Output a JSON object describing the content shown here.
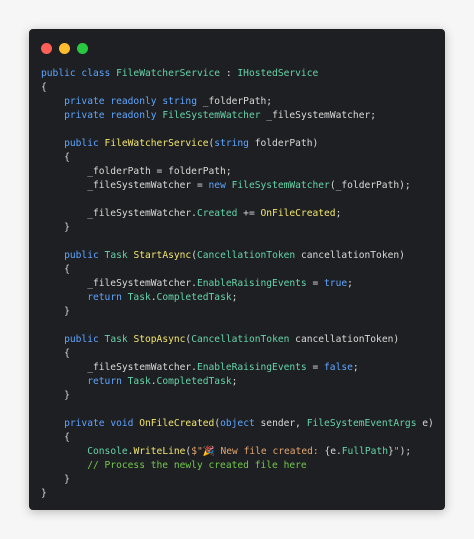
{
  "window": {
    "dots": [
      {
        "name": "close",
        "color": "#ff5f57"
      },
      {
        "name": "minimize",
        "color": "#febc2e"
      },
      {
        "name": "zoom",
        "color": "#28c840"
      }
    ]
  },
  "code_lines": [
    [
      {
        "t": "public class ",
        "c": "k"
      },
      {
        "t": "FileWatcherService",
        "c": "t"
      },
      {
        "t": " : ",
        "c": "p"
      },
      {
        "t": "IHostedService",
        "c": "t"
      }
    ],
    [
      {
        "t": "{",
        "c": "p"
      }
    ],
    [
      {
        "t": "    ",
        "c": "p"
      },
      {
        "t": "private readonly ",
        "c": "k"
      },
      {
        "t": "string",
        "c": "k"
      },
      {
        "t": " _folderPath;",
        "c": "v"
      }
    ],
    [
      {
        "t": "    ",
        "c": "p"
      },
      {
        "t": "private readonly ",
        "c": "k"
      },
      {
        "t": "FileSystemWatcher",
        "c": "t"
      },
      {
        "t": " _fileSystemWatcher;",
        "c": "v"
      }
    ],
    [],
    [
      {
        "t": "    ",
        "c": "p"
      },
      {
        "t": "public ",
        "c": "k"
      },
      {
        "t": "FileWatcherService",
        "c": "f"
      },
      {
        "t": "(",
        "c": "p"
      },
      {
        "t": "string",
        "c": "k"
      },
      {
        "t": " folderPath)",
        "c": "v"
      }
    ],
    [
      {
        "t": "    {",
        "c": "p"
      }
    ],
    [
      {
        "t": "        _folderPath = folderPath;",
        "c": "v"
      }
    ],
    [
      {
        "t": "        _fileSystemWatcher = ",
        "c": "v"
      },
      {
        "t": "new ",
        "c": "k"
      },
      {
        "t": "FileSystemWatcher",
        "c": "t"
      },
      {
        "t": "(_folderPath);",
        "c": "v"
      }
    ],
    [],
    [
      {
        "t": "        _fileSystemWatcher.",
        "c": "v"
      },
      {
        "t": "Created",
        "c": "t"
      },
      {
        "t": " += ",
        "c": "p"
      },
      {
        "t": "OnFileCreated",
        "c": "f"
      },
      {
        "t": ";",
        "c": "p"
      }
    ],
    [
      {
        "t": "    }",
        "c": "p"
      }
    ],
    [],
    [
      {
        "t": "    ",
        "c": "p"
      },
      {
        "t": "public ",
        "c": "k"
      },
      {
        "t": "Task",
        "c": "t"
      },
      {
        "t": " ",
        "c": "p"
      },
      {
        "t": "StartAsync",
        "c": "f"
      },
      {
        "t": "(",
        "c": "p"
      },
      {
        "t": "CancellationToken",
        "c": "t"
      },
      {
        "t": " cancellationToken)",
        "c": "v"
      }
    ],
    [
      {
        "t": "    {",
        "c": "p"
      }
    ],
    [
      {
        "t": "        _fileSystemWatcher.",
        "c": "v"
      },
      {
        "t": "EnableRaisingEvents",
        "c": "t"
      },
      {
        "t": " = ",
        "c": "p"
      },
      {
        "t": "true",
        "c": "k"
      },
      {
        "t": ";",
        "c": "p"
      }
    ],
    [
      {
        "t": "        ",
        "c": "p"
      },
      {
        "t": "return ",
        "c": "k"
      },
      {
        "t": "Task",
        "c": "t"
      },
      {
        "t": ".",
        "c": "p"
      },
      {
        "t": "CompletedTask",
        "c": "t"
      },
      {
        "t": ";",
        "c": "p"
      }
    ],
    [
      {
        "t": "    }",
        "c": "p"
      }
    ],
    [],
    [
      {
        "t": "    ",
        "c": "p"
      },
      {
        "t": "public ",
        "c": "k"
      },
      {
        "t": "Task",
        "c": "t"
      },
      {
        "t": " ",
        "c": "p"
      },
      {
        "t": "StopAsync",
        "c": "f"
      },
      {
        "t": "(",
        "c": "p"
      },
      {
        "t": "CancellationToken",
        "c": "t"
      },
      {
        "t": " cancellationToken)",
        "c": "v"
      }
    ],
    [
      {
        "t": "    {",
        "c": "p"
      }
    ],
    [
      {
        "t": "        _fileSystemWatcher.",
        "c": "v"
      },
      {
        "t": "EnableRaisingEvents",
        "c": "t"
      },
      {
        "t": " = ",
        "c": "p"
      },
      {
        "t": "false",
        "c": "k"
      },
      {
        "t": ";",
        "c": "p"
      }
    ],
    [
      {
        "t": "        ",
        "c": "p"
      },
      {
        "t": "return ",
        "c": "k"
      },
      {
        "t": "Task",
        "c": "t"
      },
      {
        "t": ".",
        "c": "p"
      },
      {
        "t": "CompletedTask",
        "c": "t"
      },
      {
        "t": ";",
        "c": "p"
      }
    ],
    [
      {
        "t": "    }",
        "c": "p"
      }
    ],
    [],
    [
      {
        "t": "    ",
        "c": "p"
      },
      {
        "t": "private ",
        "c": "k"
      },
      {
        "t": "void ",
        "c": "k"
      },
      {
        "t": "OnFileCreated",
        "c": "f"
      },
      {
        "t": "(",
        "c": "p"
      },
      {
        "t": "object",
        "c": "k"
      },
      {
        "t": " sender, ",
        "c": "v"
      },
      {
        "t": "FileSystemEventArgs",
        "c": "t"
      },
      {
        "t": " e)",
        "c": "v"
      }
    ],
    [
      {
        "t": "    {",
        "c": "p"
      }
    ],
    [
      {
        "t": "        ",
        "c": "p"
      },
      {
        "t": "Console",
        "c": "t"
      },
      {
        "t": ".",
        "c": "p"
      },
      {
        "t": "WriteLine",
        "c": "f"
      },
      {
        "t": "(",
        "c": "p"
      },
      {
        "t": "$\"🎉 New file created: ",
        "c": "s"
      },
      {
        "t": "{e.",
        "c": "p"
      },
      {
        "t": "FullPath",
        "c": "t"
      },
      {
        "t": "}",
        "c": "p"
      },
      {
        "t": "\"",
        "c": "s"
      },
      {
        "t": ");",
        "c": "p"
      }
    ],
    [
      {
        "t": "        // Process the newly created file here",
        "c": "c"
      }
    ],
    [
      {
        "t": "    }",
        "c": "p"
      }
    ],
    [
      {
        "t": "}",
        "c": "p"
      }
    ]
  ]
}
